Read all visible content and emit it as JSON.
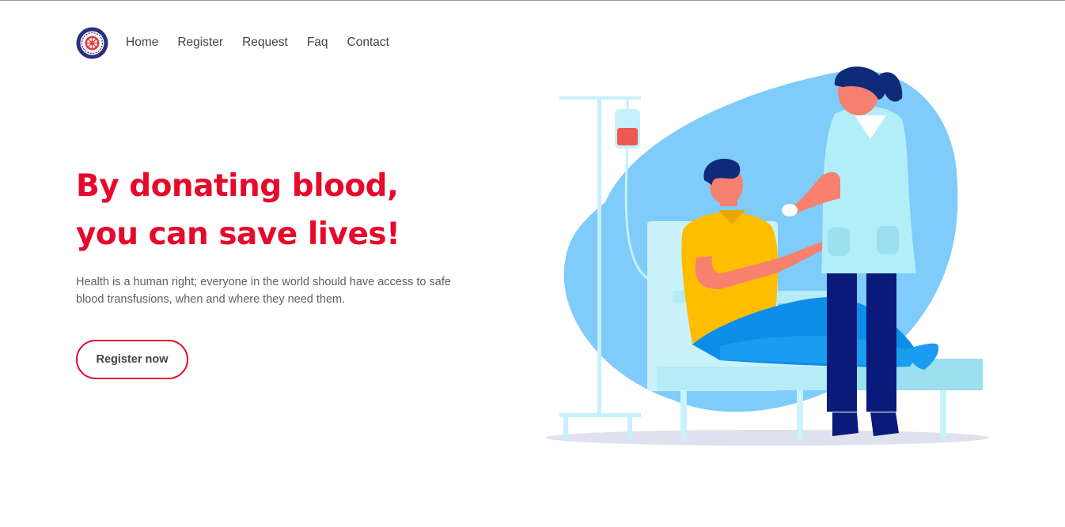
{
  "nav": {
    "logo_alt": "Blood bank emblem",
    "items": [
      {
        "label": "Home"
      },
      {
        "label": "Register"
      },
      {
        "label": "Request"
      },
      {
        "label": "Faq"
      },
      {
        "label": "Contact"
      }
    ]
  },
  "hero": {
    "title_line1": "By donating blood,",
    "title_line2": "you can save lives!",
    "description": "Health is a human right; everyone in the world should have access to safe blood transfusions, when and where they need them.",
    "cta_label": "Register now"
  },
  "colors": {
    "accent": "#e6092b",
    "nav_text": "#444444",
    "body_text": "#5f5f5f",
    "blob": "#7fcbfa"
  },
  "icons": {
    "logo": "blood-bank-logo-icon",
    "illustration": "blood-donation-illustration"
  }
}
